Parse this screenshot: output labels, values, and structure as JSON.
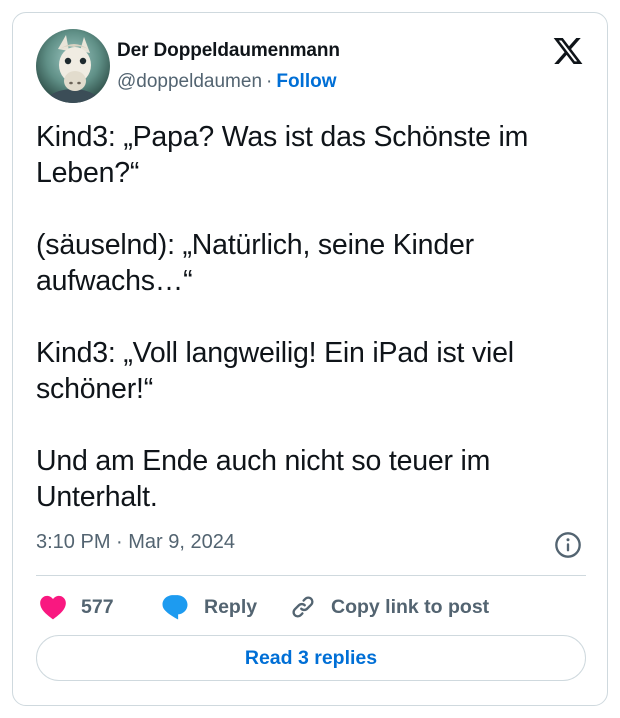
{
  "author": {
    "name": "Der Doppeldaumenmann",
    "handle": "@doppeldaumen",
    "separator": "·",
    "follow_label": "Follow",
    "avatar_icon": "avatar-horse-image"
  },
  "platform_icon": "x-logo-icon",
  "tweet": {
    "paragraphs": [
      "Kind3: „Papa? Was ist das Schönste im Leben?“",
      "(säuselnd): „Natürlich, seine Kinder aufwachs…“",
      "Kind3: „Voll langweilig! Ein iPad ist viel schöner!“",
      "Und am Ende auch nicht so teuer im Unterhalt."
    ],
    "timestamp": "3:10 PM · Mar 9, 2024"
  },
  "actions": {
    "like_count": "577",
    "reply_label": "Reply",
    "copy_link_label": "Copy link to post"
  },
  "read_replies_label": "Read 3 replies",
  "colors": {
    "like": "#f91880",
    "reply": "#1d9bf0",
    "link": "#006fd6",
    "secondary_text": "#536471",
    "border": "#cfd9de"
  }
}
